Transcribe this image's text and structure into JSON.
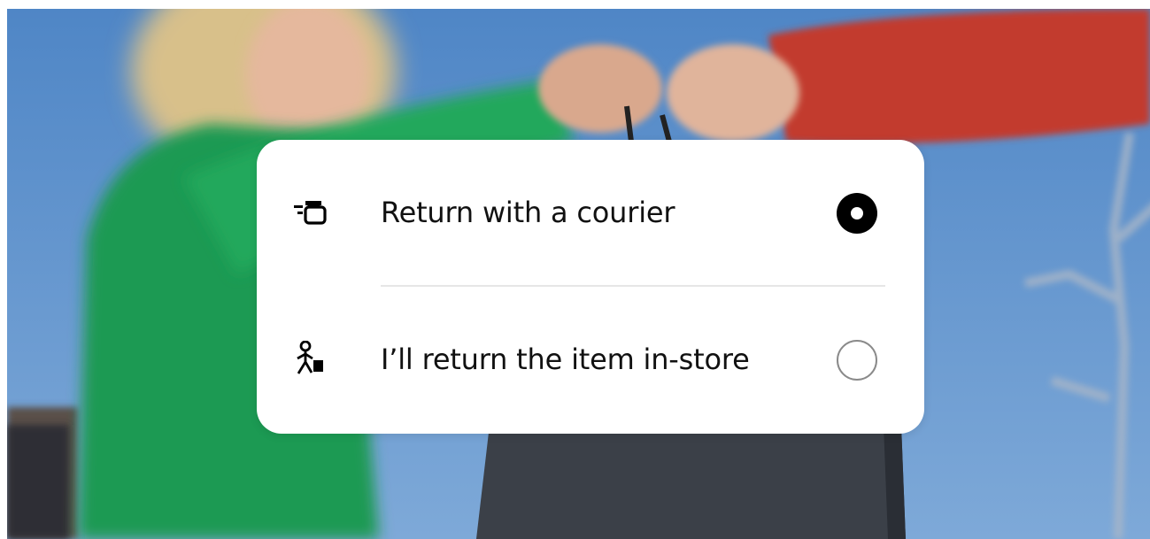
{
  "options": [
    {
      "label": "Return with a courier",
      "icon": "courier-box-icon",
      "selected": true
    },
    {
      "label": "I’ll return the item in-store",
      "icon": "person-walking-bag-icon",
      "selected": false
    }
  ],
  "colors": {
    "sky": "#5b8fc9",
    "sweater_green": "#1fa057",
    "sleeve_red": "#c8392c",
    "bag_dark": "#3a3f46",
    "radio_selected": "#000000",
    "radio_unselected_border": "#8a8a8a"
  }
}
